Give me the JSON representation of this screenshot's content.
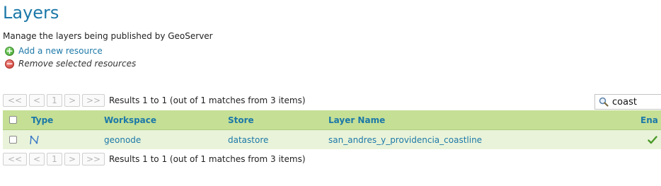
{
  "page": {
    "title": "Layers",
    "description": "Manage the layers being published by GeoServer"
  },
  "actions": {
    "add_label": "Add a new resource",
    "remove_label": "Remove selected resources"
  },
  "pager": {
    "first": "<<",
    "prev": "<",
    "page": "1",
    "next": ">",
    "last": ">>",
    "info": "Results 1 to 1 (out of 1 matches from 3 items)"
  },
  "search": {
    "value": "coast"
  },
  "table": {
    "headers": {
      "type": "Type",
      "workspace": "Workspace",
      "store": "Store",
      "layer_name": "Layer Name",
      "enabled": "Ena"
    },
    "rows": [
      {
        "type_icon": "line-layer-icon",
        "workspace": "geonode",
        "store": "datastore",
        "layer_name": "san_andres_y_providencia_coastline",
        "enabled": true
      }
    ]
  },
  "colors": {
    "title": "#1c78a8",
    "header_bg": "#c5df95",
    "row_bg": "#e9f3d9",
    "enabled_check": "#4a9a2a"
  }
}
